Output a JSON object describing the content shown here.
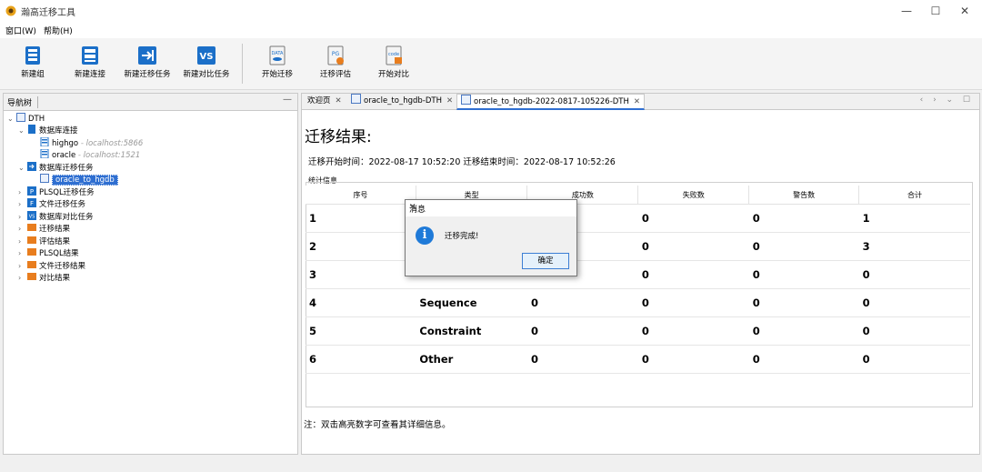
{
  "window": {
    "title": "瀚高迁移工具",
    "minimize": "—",
    "maximize": "☐",
    "close": "✕"
  },
  "menu": [
    {
      "label": "窗口(W)"
    },
    {
      "label": "帮助(H)"
    }
  ],
  "toolbar": {
    "items": [
      {
        "label": "新建组",
        "icon": "group-icon"
      },
      {
        "label": "新建连接",
        "icon": "connection-icon"
      },
      {
        "label": "新建迁移任务",
        "icon": "migration-task-icon"
      },
      {
        "label": "新建对比任务",
        "icon": "compare-task-icon",
        "badge": "VS"
      },
      {
        "label": "开始迁移",
        "icon": "start-migration-icon",
        "badge": "DATA"
      },
      {
        "label": "迁移评估",
        "icon": "evaluate-icon",
        "badge": "PG"
      },
      {
        "label": "开始对比",
        "icon": "start-compare-icon",
        "badge": "code"
      }
    ]
  },
  "nav": {
    "title": "导航树",
    "min_symbol": "—",
    "tree": {
      "root": "DTH",
      "db_conn": "数据库连接",
      "conn_highgo": "highgo",
      "conn_highgo_host": "- localhost:5866",
      "conn_oracle": "oracle",
      "conn_oracle_host": "- localhost:1521",
      "db_migration": "数据库迁移任务",
      "task_selected": "oracle_to_hgdb",
      "plsql_task": "PLSQL迁移任务",
      "file_task": "文件迁移任务",
      "compare_task": "数据库对比任务",
      "migration_result": "迁移结果",
      "eval_result": "评估结果",
      "plsql_result": "PLSQL结果",
      "file_result": "文件迁移结果",
      "compare_result": "对比结果"
    }
  },
  "tabs": [
    {
      "label": "欢迎页"
    },
    {
      "label": "oracle_to_hgdb-DTH"
    },
    {
      "label": "oracle_to_hgdb-2022-0817-105226-DTH"
    }
  ],
  "tab_controls": "‹ › ⌄ ☐",
  "result": {
    "title": "迁移结果:",
    "time_line": "迁移开始时间：2022-08-17 10:52:20  迁移结束时间：2022-08-17 10:52:26",
    "stats_label": "统计信息",
    "columns": [
      "序号",
      "类型",
      "成功数",
      "失败数",
      "警告数",
      "合计"
    ],
    "rows": [
      [
        "1",
        "",
        "",
        "0",
        "0",
        "1"
      ],
      [
        "2",
        "",
        "",
        "0",
        "0",
        "3"
      ],
      [
        "3",
        "",
        "",
        "0",
        "0",
        "0"
      ],
      [
        "4",
        "Sequence",
        "0",
        "0",
        "0",
        "0"
      ],
      [
        "5",
        "Constraint",
        "0",
        "0",
        "0",
        "0"
      ],
      [
        "6",
        "Other",
        "0",
        "0",
        "0",
        "0"
      ]
    ],
    "note": "注：双击高亮数字可查看其详细信息。"
  },
  "dialog": {
    "title": "消息",
    "message": "迁移完成!",
    "ok": "确定",
    "close": "✕",
    "icon_glyph": "i"
  },
  "colors": {
    "accent": "#2f6fd1",
    "info": "#1f7ad8"
  }
}
